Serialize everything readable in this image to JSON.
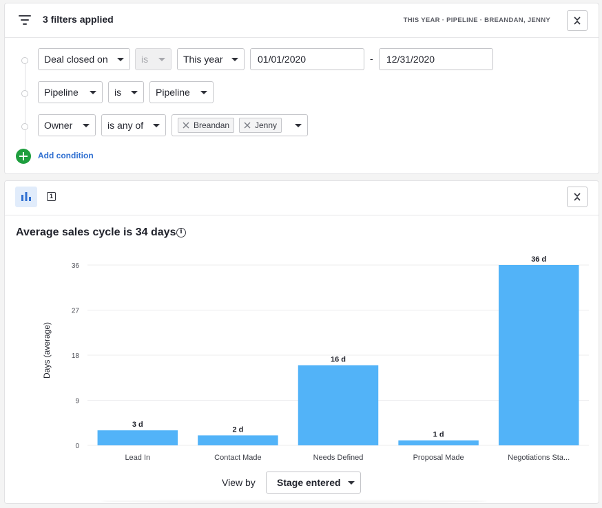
{
  "filters": {
    "title": "3 filters applied",
    "summary": "THIS YEAR  ·  PIPELINE  ·  BREANDAN, JENNY",
    "conditions": [
      {
        "field": "Deal closed on",
        "operator": "is",
        "value": "This year",
        "date_from": "01/01/2020",
        "date_separator": "-",
        "date_to": "12/31/2020"
      },
      {
        "field": "Pipeline",
        "operator": "is",
        "value": "Pipeline"
      },
      {
        "field": "Owner",
        "operator": "is any of",
        "tags": [
          "Breandan",
          "Jenny"
        ]
      }
    ],
    "add_condition_label": "Add condition"
  },
  "report": {
    "tab_number": "1",
    "title": "Average sales cycle is 34 days",
    "info_symbol": "i",
    "view_by_label": "View by",
    "view_by_value": "Stage entered"
  },
  "chart_data": {
    "type": "bar",
    "categories": [
      "Lead In",
      "Contact Made",
      "Needs Defined",
      "Proposal Made",
      "Negotiations Sta..."
    ],
    "values": [
      3,
      2,
      16,
      1,
      36
    ],
    "data_labels": [
      "3 d",
      "2 d",
      "16 d",
      "1 d",
      "36 d"
    ],
    "ylabel": "Days (average)",
    "yticks": [
      0,
      9,
      18,
      27,
      36
    ],
    "ylim": [
      0,
      36
    ],
    "grid": true,
    "bar_color": "#52b3f8"
  },
  "colors": {
    "accent": "#2f6fd1",
    "add_button": "#1e9e3e",
    "bar": "#52b3f8"
  }
}
